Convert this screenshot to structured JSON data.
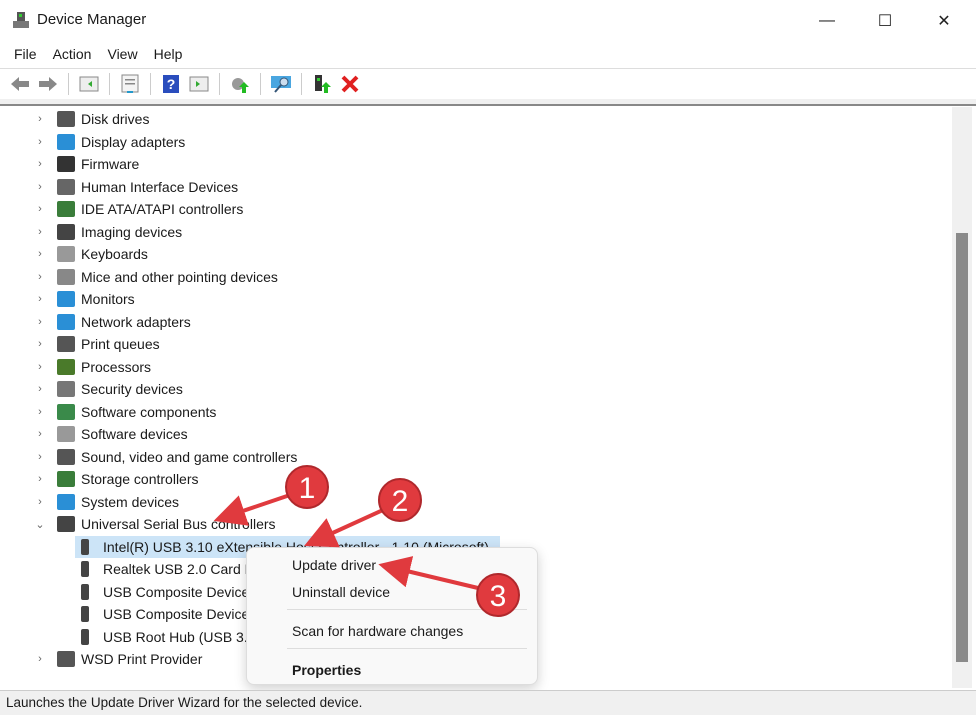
{
  "window": {
    "title": "Device Manager",
    "minimize": "—",
    "maximize": "☐",
    "close": "✕"
  },
  "menu": [
    "File",
    "Action",
    "View",
    "Help"
  ],
  "toolbar": [
    "back-icon",
    "forward-icon",
    "show-hide-console-tree-icon",
    "properties-icon",
    "help-icon",
    "action-pane-icon",
    "update-driver-icon",
    "scan-hardware-icon",
    "add-driver-icon",
    "uninstall-icon"
  ],
  "tree": [
    {
      "label": "Disk drives",
      "expanded": false,
      "color": "#555"
    },
    {
      "label": "Display adapters",
      "expanded": false,
      "color": "#2a8fd6"
    },
    {
      "label": "Firmware",
      "expanded": false,
      "color": "#333"
    },
    {
      "label": "Human Interface Devices",
      "expanded": false,
      "color": "#666"
    },
    {
      "label": "IDE ATA/ATAPI controllers",
      "expanded": false,
      "color": "#3a7d3a"
    },
    {
      "label": "Imaging devices",
      "expanded": false,
      "color": "#444"
    },
    {
      "label": "Keyboards",
      "expanded": false,
      "color": "#999"
    },
    {
      "label": "Mice and other pointing devices",
      "expanded": false,
      "color": "#888"
    },
    {
      "label": "Monitors",
      "expanded": false,
      "color": "#2a8fd6"
    },
    {
      "label": "Network adapters",
      "expanded": false,
      "color": "#2a8fd6"
    },
    {
      "label": "Print queues",
      "expanded": false,
      "color": "#555"
    },
    {
      "label": "Processors",
      "expanded": false,
      "color": "#4a7a2a"
    },
    {
      "label": "Security devices",
      "expanded": false,
      "color": "#777"
    },
    {
      "label": "Software components",
      "expanded": false,
      "color": "#3a8a4a"
    },
    {
      "label": "Software devices",
      "expanded": false,
      "color": "#999"
    },
    {
      "label": "Sound, video and game controllers",
      "expanded": false,
      "color": "#555"
    },
    {
      "label": "Storage controllers",
      "expanded": false,
      "color": "#3a7d3a"
    },
    {
      "label": "System devices",
      "expanded": false,
      "color": "#2a8fd6"
    },
    {
      "label": "Universal Serial Bus controllers",
      "expanded": true,
      "color": "#444"
    },
    {
      "label": "Intel(R) USB 3.10 eXtensible Host Controller - 1.10 (Microsoft)",
      "child": true,
      "selected": true,
      "color": "#444"
    },
    {
      "label": "Realtek USB 2.0 Card Reader",
      "child": true,
      "color": "#444"
    },
    {
      "label": "USB Composite Device",
      "child": true,
      "color": "#444"
    },
    {
      "label": "USB Composite Device",
      "child": true,
      "color": "#444"
    },
    {
      "label": "USB Root Hub (USB 3.0)",
      "child": true,
      "color": "#444"
    },
    {
      "label": "WSD Print Provider",
      "expanded": false,
      "color": "#555"
    }
  ],
  "context_menu": {
    "update": "Update driver",
    "uninstall": "Uninstall device",
    "scan": "Scan for hardware changes",
    "properties": "Properties"
  },
  "annotations": [
    "1",
    "2",
    "3"
  ],
  "annotation_color": "#e03a3e",
  "status": "Launches the Update Driver Wizard for the selected device."
}
